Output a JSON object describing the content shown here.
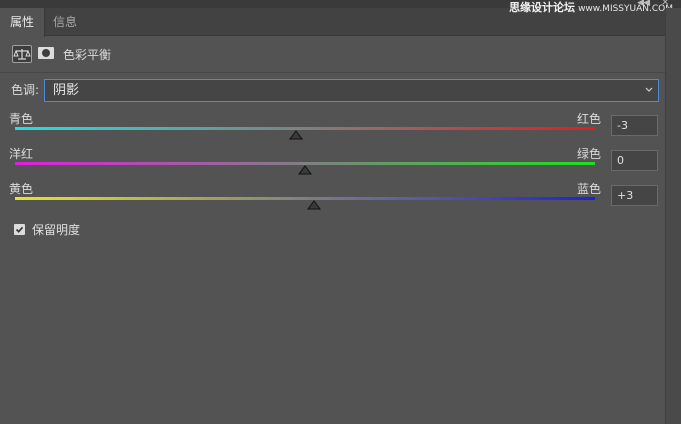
{
  "panel": {
    "tabs": [
      {
        "label": "属性",
        "active": true
      },
      {
        "label": "信息",
        "active": false
      }
    ],
    "watermark": {
      "text": "思缘设计论坛",
      "url": "www.MISSYUAN.COM"
    },
    "header": {
      "title": "色彩平衡",
      "icons": [
        "balance-scale-icon",
        "mask-icon"
      ]
    }
  },
  "tone": {
    "label": "色调:",
    "selected": "阴影"
  },
  "sliders": [
    {
      "left_label": "青色",
      "right_label": "红色",
      "value": "-3",
      "numeric": -3,
      "range": [
        -100,
        100
      ],
      "left_color": "#1fe0e6",
      "right_color": "#e01e1e"
    },
    {
      "left_label": "洋红",
      "right_label": "绿色",
      "value": "0",
      "numeric": 0,
      "range": [
        -100,
        100
      ],
      "left_color": "#e01fe0",
      "right_color": "#1ee01e"
    },
    {
      "left_label": "黄色",
      "right_label": "蓝色",
      "value": "+3",
      "numeric": 3,
      "range": [
        -100,
        100
      ],
      "left_color": "#e6e61f",
      "right_color": "#1f1fe0"
    }
  ],
  "preserve_luminosity": {
    "label": "保留明度",
    "checked": true
  },
  "colors": {
    "panel_bg": "#535353",
    "tab_bar_bg": "#424242",
    "select_focus_border": "#4f8ad8"
  }
}
